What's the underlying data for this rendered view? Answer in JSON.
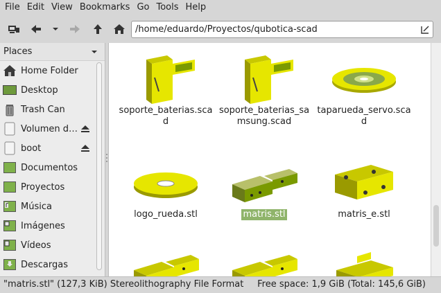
{
  "menu": [
    "File",
    "Edit",
    "View",
    "Bookmarks",
    "Go",
    "Tools",
    "Help"
  ],
  "location": {
    "path": "/home/eduardo/Proyectos/qubotica-scad"
  },
  "sidebar": {
    "header": "Places",
    "items": [
      {
        "label": "Home Folder",
        "icon": "home-icon",
        "eject": false
      },
      {
        "label": "Desktop",
        "icon": "desktop-icon",
        "eject": false
      },
      {
        "label": "Trash Can",
        "icon": "trash-icon",
        "eject": false
      },
      {
        "label": "Volumen d…",
        "icon": "drive-icon",
        "eject": true
      },
      {
        "label": "boot",
        "icon": "drive-icon",
        "eject": true
      },
      {
        "label": "Documentos",
        "icon": "folder-icon",
        "eject": false
      },
      {
        "label": "Proyectos",
        "icon": "folder-icon",
        "eject": false
      },
      {
        "label": "Música",
        "icon": "music-folder-icon",
        "eject": false
      },
      {
        "label": "Imágenes",
        "icon": "pictures-folder-icon",
        "eject": false
      },
      {
        "label": "Vídeos",
        "icon": "videos-folder-icon",
        "eject": false
      },
      {
        "label": "Descargas",
        "icon": "downloads-folder-icon",
        "eject": false
      }
    ]
  },
  "files": [
    {
      "name": "soporte_baterias.scad",
      "thumb": "battery-holder"
    },
    {
      "name": "soporte_baterias_samsung.scad",
      "thumb": "battery-holder"
    },
    {
      "name": "taparueda_servo.scad",
      "thumb": "wheel-cap"
    },
    {
      "name": "logo_rueda.stl",
      "thumb": "wheel"
    },
    {
      "name": "matris.stl",
      "thumb": "matrix-dark",
      "selected": true
    },
    {
      "name": "matris_e.stl",
      "thumb": "matrix-box"
    },
    {
      "name": "",
      "thumb": "matrix-pair"
    },
    {
      "name": "",
      "thumb": "matrix-pair"
    },
    {
      "name": "",
      "thumb": "matrix-flat"
    }
  ],
  "status": {
    "left": "\"matris.stl\" (127,3 KiB) Stereolithography File Format",
    "right": "Free space: 1,9 GiB (Total: 145,6 GiB)"
  },
  "colors": {
    "accent": "#8fb46a",
    "model_yellow": "#e6e600",
    "model_green": "#7a9a00"
  }
}
